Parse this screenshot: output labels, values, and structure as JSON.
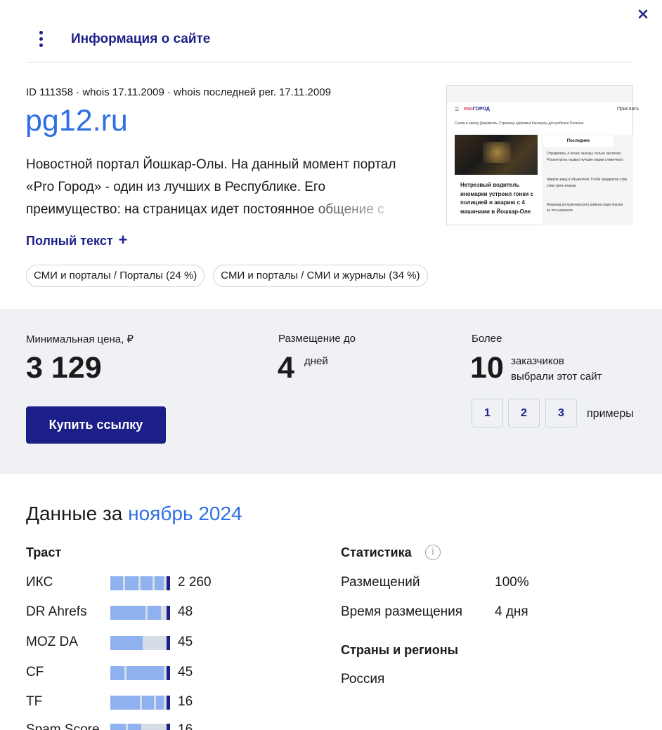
{
  "header": {
    "title": "Информация о сайте"
  },
  "site": {
    "meta": "ID 111358 · whois 17.11.2009 · whois последней рег. 17.11.2009",
    "domain": "pg12.ru",
    "description": "Новостной портал Йошкар-Олы. На данный момент портал «Pro Город» - один из лучших в Республике. Его преимущество: на страницах идет постоянное общение с",
    "full_text_label": "Полный текст",
    "tags": [
      "СМИ и порталы / Порталы (24 %)",
      "СМИ и порталы / СМИ и журналы (34 %)"
    ]
  },
  "preview": {
    "logo": "ГОРОД",
    "logo_prefix": "PRO",
    "right_text": "Прислать",
    "menu": "Снова в школу     Документы     Страница здоровья     Каникулы для ребенка     Полезно",
    "headline": "Нетрезвый водитель иномарки устроил гонки с полицией и аварию с 4 машинами в Йошкар-Оле",
    "side_head": "Последнее",
    "side_items": [
      "Отравились 4 почки: внутры только частично",
      "Росконтроль назвал лучшие марки сливочного",
      "Чирков зажд в обыватели: Глоба предрекла стра",
      "этим трем знакам",
      "Инвалид из Куженерского района сама покупа",
      "за это наказали"
    ]
  },
  "pricing": {
    "min_price_label": "Минимальная цена, ₽",
    "min_price": "3 129",
    "placement_label": "Размещение до",
    "placement_value": "4",
    "placement_unit": "дней",
    "customers_label": "Более",
    "customers_value": "10",
    "customers_text_1": "заказчиков",
    "customers_text_2": "выбрали этот сайт",
    "buy_label": "Купить ссылку",
    "examples": [
      "1",
      "2",
      "3"
    ],
    "examples_label": "примеры"
  },
  "data_section": {
    "title_prefix": "Данные за",
    "title_period": "ноябрь 2024",
    "trust_title": "Траст",
    "trust": [
      {
        "label": "ИКС",
        "value": "2 260",
        "fill": 0.95
      },
      {
        "label": "DR Ahrefs",
        "value": "48",
        "fill": 0.9
      },
      {
        "label": "MOZ DA",
        "value": "45",
        "fill": 0.57
      },
      {
        "label": "CF",
        "value": "45",
        "fill": 0.95
      },
      {
        "label": "TF",
        "value": "16",
        "fill": 0.95
      },
      {
        "label": "Spam Score",
        "value": "16",
        "fill": 0.55
      }
    ],
    "stats_title": "Статистика",
    "stats": [
      {
        "label": "Размещений",
        "value": "100%"
      },
      {
        "label": "Время размещения",
        "value": "4 дня"
      }
    ],
    "regions_title": "Страны и регионы",
    "regions": [
      "Россия"
    ]
  },
  "colors": {
    "accent": "#1b1f87",
    "link": "#2f6fe4",
    "band": "#eff1f4",
    "bar_fill": "#8fb1ef",
    "bar_bg": "#d6dde6"
  }
}
